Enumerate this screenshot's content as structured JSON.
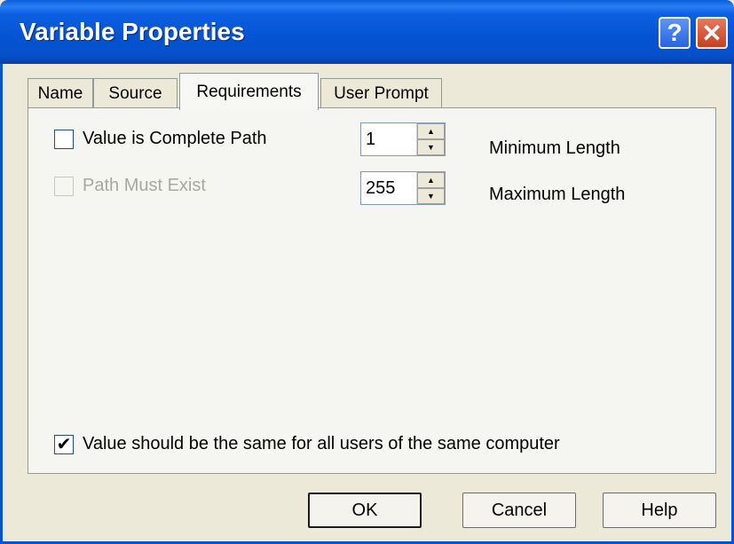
{
  "window": {
    "title": "Variable Properties"
  },
  "titlebar": {
    "help_label": "?",
    "close_label": "✕"
  },
  "tabs": [
    {
      "label": "Name"
    },
    {
      "label": "Source"
    },
    {
      "label": "Requirements",
      "active": true
    },
    {
      "label": "User Prompt"
    }
  ],
  "requirements": {
    "complete_path": {
      "label": "Value is Complete Path",
      "checked": false,
      "enabled": true
    },
    "path_must_exist": {
      "label": "Path Must Exist",
      "checked": false,
      "enabled": false
    },
    "min_length": {
      "value": "1",
      "label": "Minimum Length"
    },
    "max_length": {
      "value": "255",
      "label": "Maximum Length"
    },
    "same_for_all_users": {
      "label": "Value should be the same for all users of the same computer",
      "checked": true,
      "check_glyph": "✔"
    }
  },
  "buttons": {
    "ok": "OK",
    "cancel": "Cancel",
    "help": "Help"
  },
  "colors": {
    "titlebar": "#0553d3",
    "face": "#ece9d8",
    "panel": "#f5f5f1",
    "disabled_text": "#a9a89f"
  }
}
